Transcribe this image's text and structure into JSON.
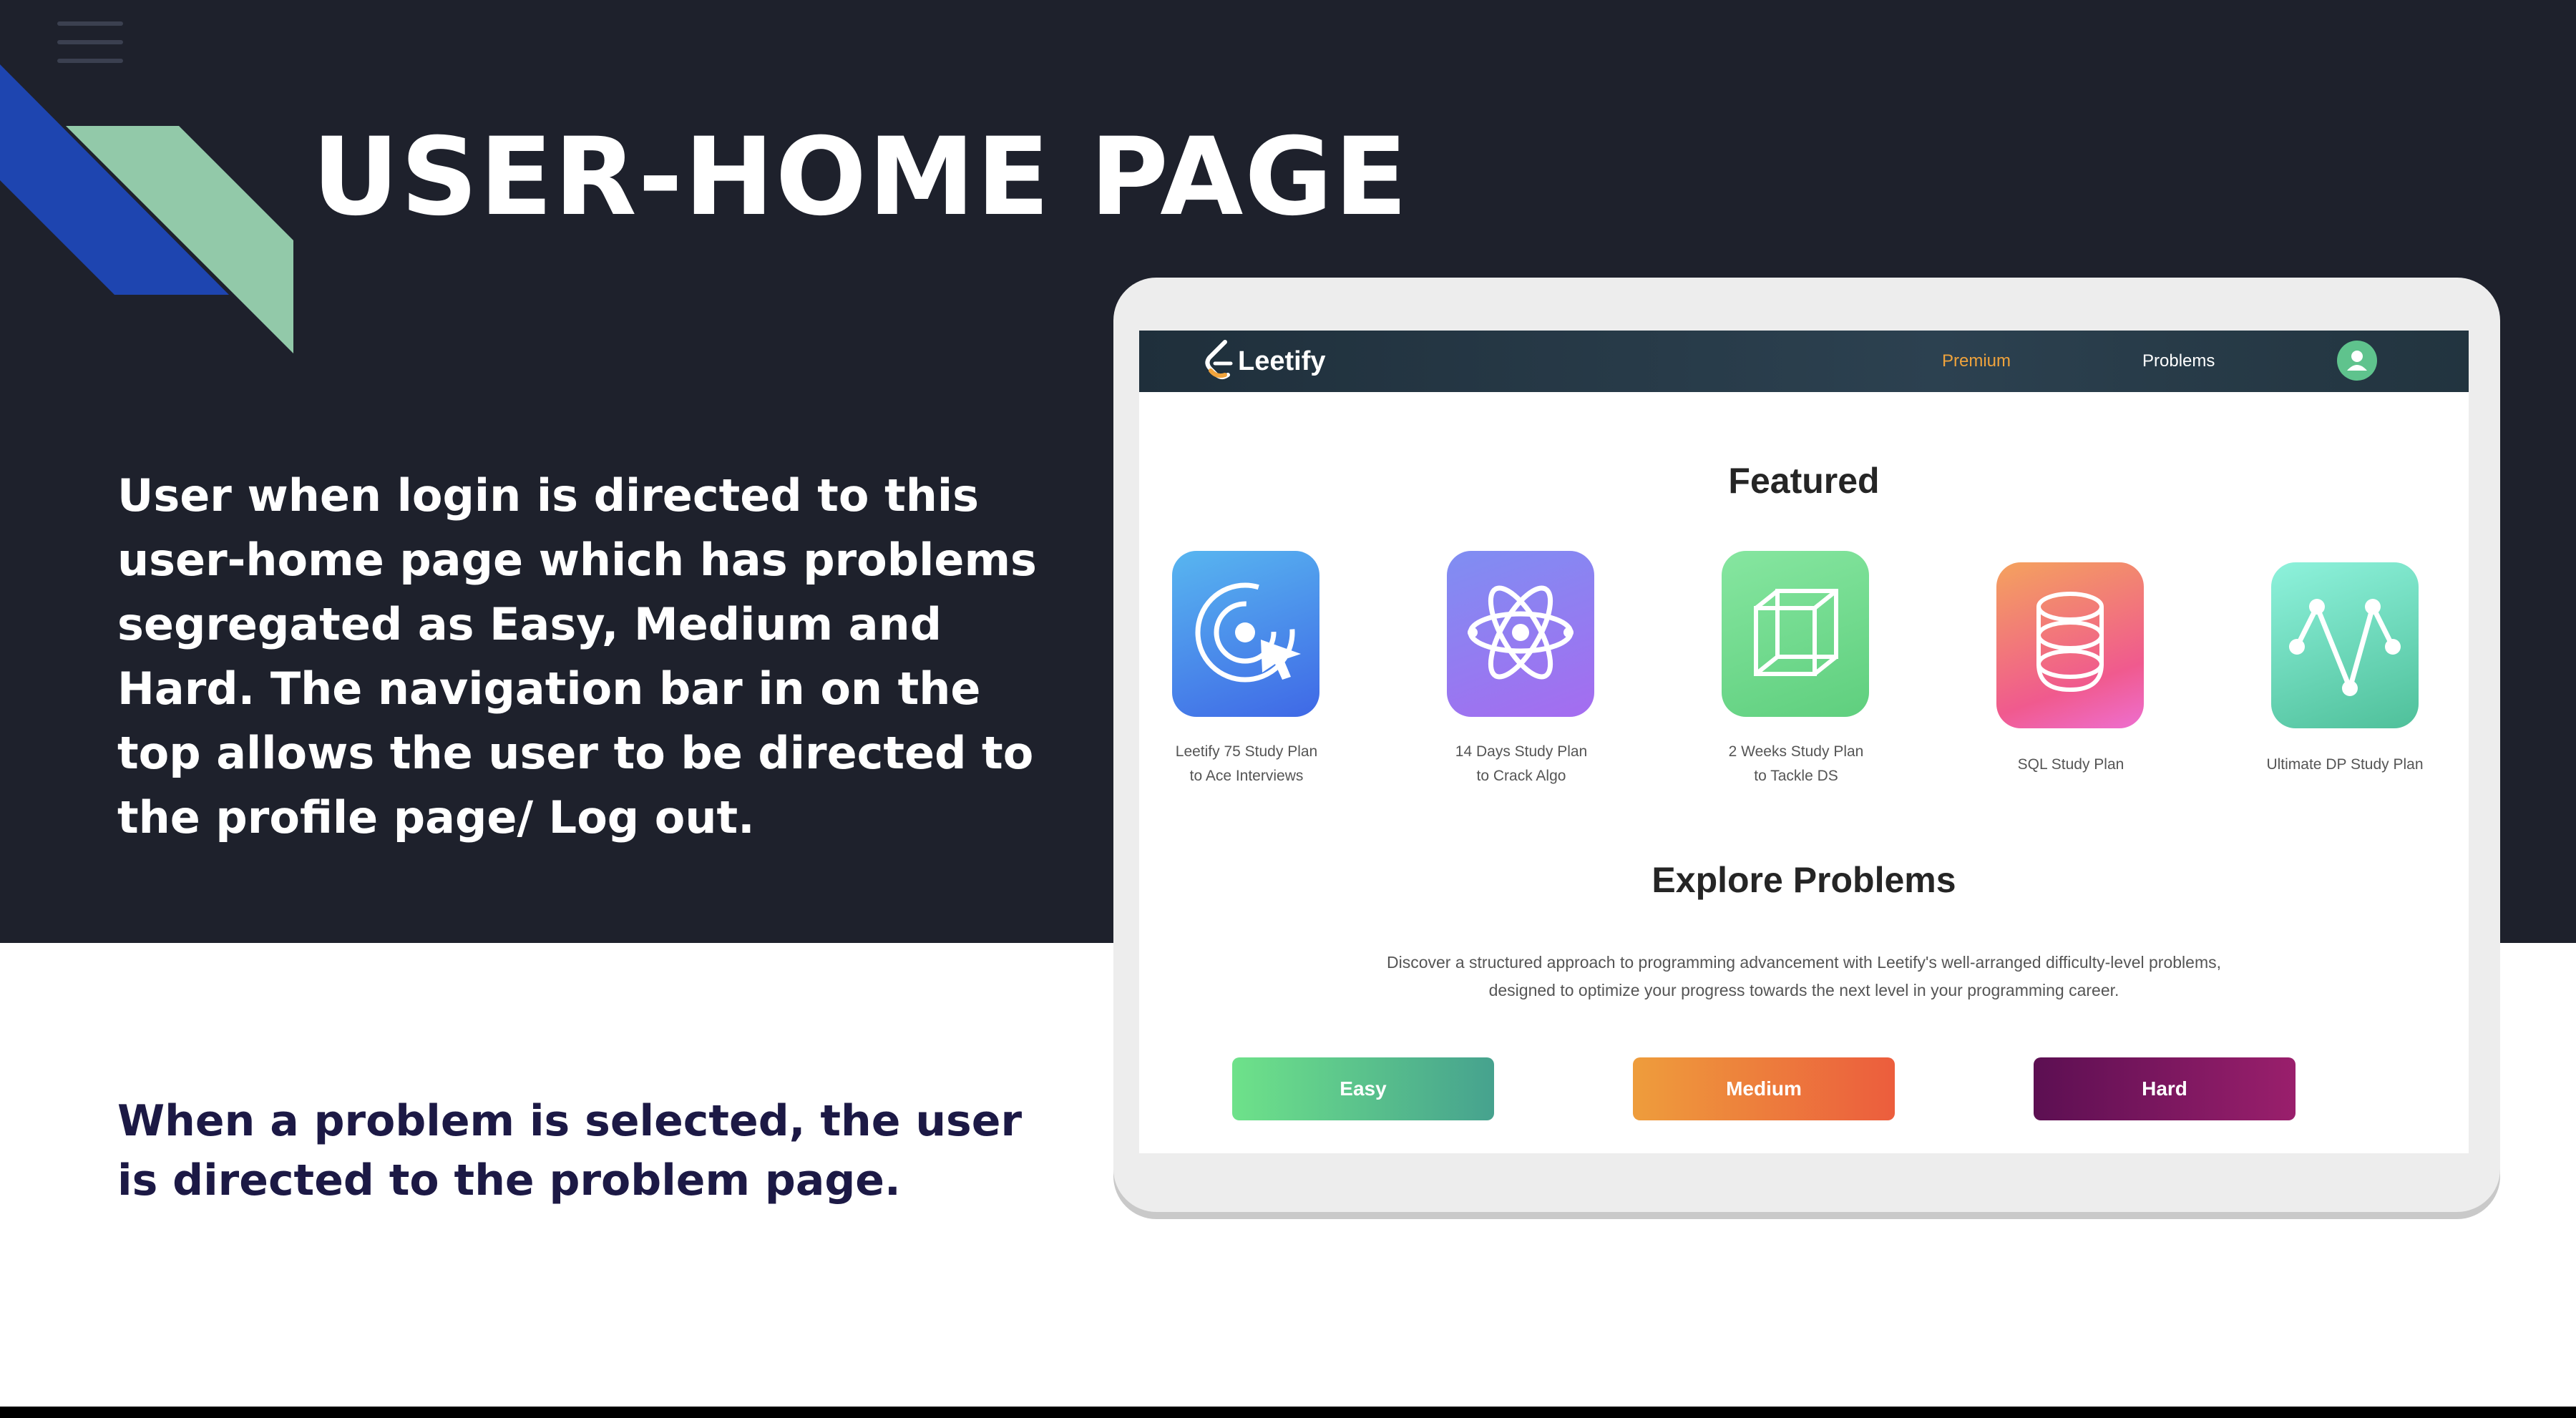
{
  "slide": {
    "title": "USER-HOME PAGE",
    "description": "User when login is directed to this user-home page which has problems segregated as Easy, Medium and Hard. The navigation bar in on the top allows the user to be directed to the profile page/ Log out.",
    "note": "When a problem is selected, the user is directed to the problem page.",
    "icons": {
      "menu": "hamburger-menu-icon"
    },
    "colors": {
      "dark_band": "#1e212c",
      "accent_blue": "#1e45b0",
      "accent_green": "#92c9a9",
      "note_text": "#1c1945"
    }
  },
  "app": {
    "brand": "Leetify",
    "nav": {
      "premium": "Premium",
      "problems": "Problems"
    },
    "icons": {
      "logo": "leetify-logo-icon",
      "avatar": "user-avatar-icon"
    },
    "colors": {
      "premium": "#f0a33c",
      "avatar": "#5fc38d"
    },
    "featured": {
      "title": "Featured",
      "cards": [
        {
          "line1": "Leetify 75 Study Plan",
          "line2": "to Ace Interviews",
          "icon": "target-cursor-icon"
        },
        {
          "line1": "14 Days Study Plan",
          "line2": "to Crack Algo",
          "icon": "atom-icon"
        },
        {
          "line1": "2 Weeks Study Plan",
          "line2": "to Tackle DS",
          "icon": "cube-icon"
        },
        {
          "line1": "SQL Study Plan",
          "line2": "",
          "icon": "database-icon"
        },
        {
          "line1": "Ultimate DP Study Plan",
          "line2": "",
          "icon": "graph-path-icon"
        }
      ]
    },
    "explore": {
      "title": "Explore Problems",
      "description_line1": "Discover a structured approach to programming advancement with Leetify's well-arranged difficulty-level problems,",
      "description_line2": "designed to optimize your progress towards the next level in your programming career.",
      "buttons": {
        "easy": "Easy",
        "medium": "Medium",
        "hard": "Hard"
      }
    }
  }
}
